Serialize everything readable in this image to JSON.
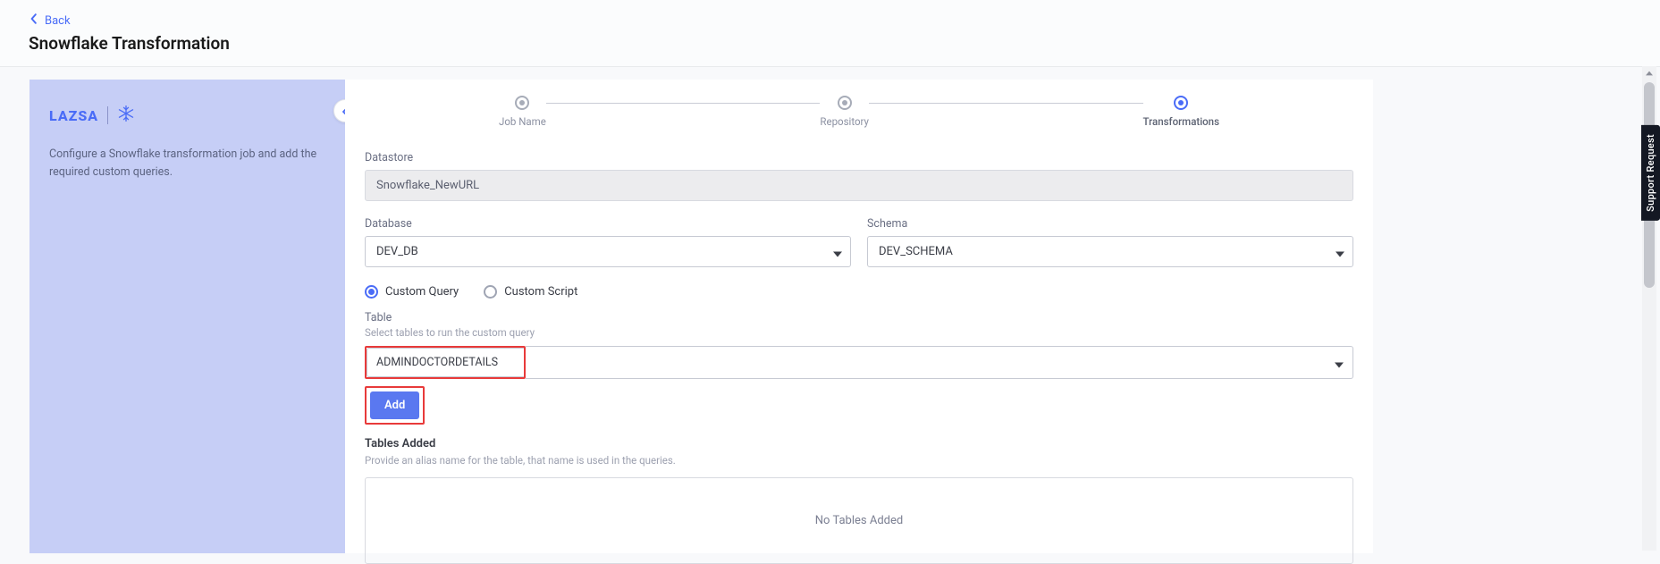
{
  "header": {
    "back_label": "Back",
    "title": "Snowflake Transformation"
  },
  "sidebar": {
    "brand": "LAZSA",
    "description": "Configure a Snowflake transformation job and add the required custom queries."
  },
  "stepper": {
    "steps": [
      {
        "label": "Job Name"
      },
      {
        "label": "Repository"
      },
      {
        "label": "Transformations"
      }
    ]
  },
  "form": {
    "datastore_label": "Datastore",
    "datastore_value": "Snowflake_NewURL",
    "database_label": "Database",
    "database_value": "DEV_DB",
    "schema_label": "Schema",
    "schema_value": "DEV_SCHEMA",
    "radio_query": "Custom Query",
    "radio_script": "Custom Script",
    "table_label": "Table",
    "table_sublabel": "Select tables to run the custom query",
    "table_value": "ADMINDOCTORDETAILS",
    "add_button": "Add",
    "tables_added_title": "Tables Added",
    "tables_added_sublabel": "Provide an alias name for the table, that name is used in the queries.",
    "no_tables_text": "No Tables Added"
  },
  "support_tab": "Support Request"
}
